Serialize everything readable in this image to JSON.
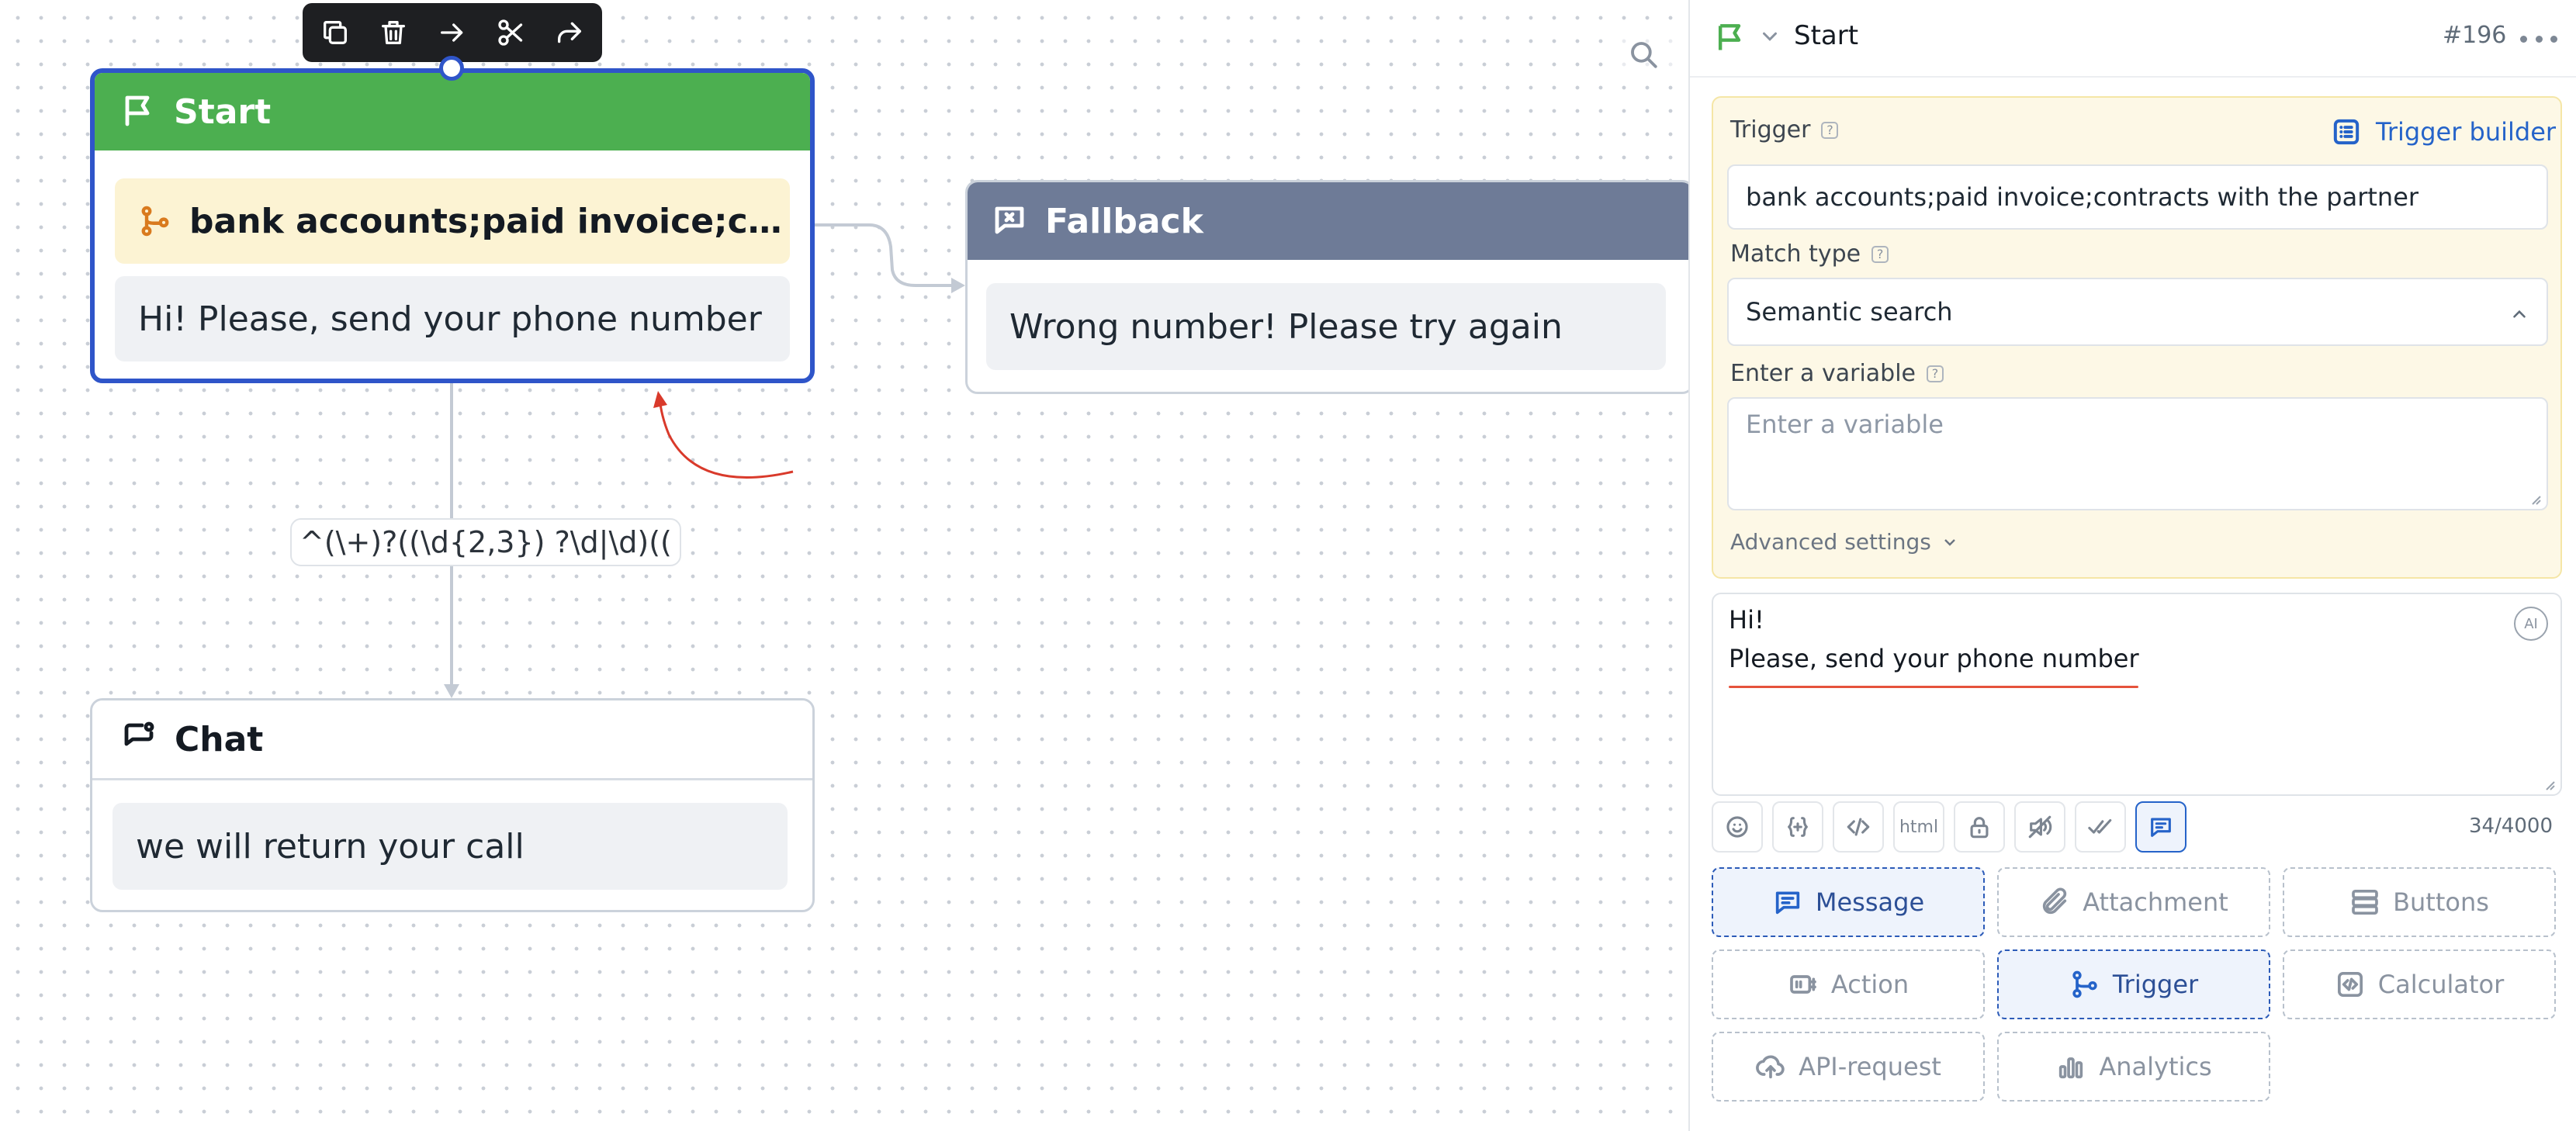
{
  "canvas": {
    "toolbar": {
      "copy": "copy-icon",
      "delete": "trash-icon",
      "connect": "arrow-right-icon",
      "cut": "scissors-icon",
      "share": "share-icon"
    },
    "search_icon": "search-icon",
    "nodes": {
      "start": {
        "title": "Start",
        "icon": "flag-icon",
        "header_color": "#4caf50",
        "trigger_text": "bank accounts;paid invoice;contra...",
        "message": "Hi! Please, send your phone number"
      },
      "fallback": {
        "title": "Fallback",
        "icon": "message-x-icon",
        "header_color": "#6e7b97",
        "message": "Wrong number! Please try again"
      },
      "chat": {
        "title": "Chat",
        "icon": "chat-bubble-icon",
        "message": "we will return your call"
      }
    },
    "edge_label": "^(\\+)?((\\d{2,3}) ?\\d|\\d)(("
  },
  "panel": {
    "header": {
      "title": "Start",
      "id": "#196"
    },
    "trigger": {
      "label": "Trigger",
      "builder_label": "Trigger builder",
      "value": "bank accounts;paid invoice;contracts with the partner",
      "match_type_label": "Match type",
      "match_type_value": "Semantic search",
      "variable_label": "Enter a variable",
      "variable_placeholder": "Enter a variable",
      "advanced_label": "Advanced settings"
    },
    "message": {
      "line1": "Hi!",
      "line2": "Please, send your phone number",
      "ai_label": "AI",
      "counter": "34/4000"
    },
    "format_tools": [
      "emoji-icon",
      "variable-icon",
      "code-icon",
      "html",
      "lock-icon",
      "no-sound-icon",
      "double-check-icon",
      "message-icon"
    ],
    "add_blocks": {
      "message": "Message",
      "attachment": "Attachment",
      "buttons": "Buttons",
      "action": "Action",
      "trigger": "Trigger",
      "calculator": "Calculator",
      "api_request": "API-request",
      "analytics": "Analytics"
    }
  },
  "colors": {
    "accent": "#2563c9",
    "start_border": "#2f55c9",
    "trigger_bg": "#fdf8e6"
  }
}
